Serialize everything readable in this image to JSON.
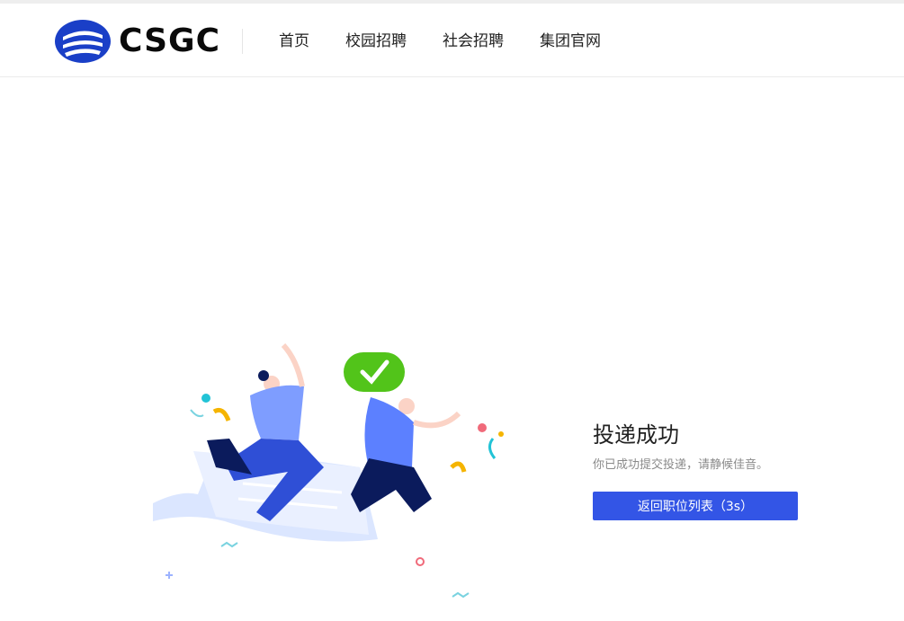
{
  "header": {
    "logo_text": "CSGC",
    "nav": [
      {
        "label": "首页"
      },
      {
        "label": "校园招聘"
      },
      {
        "label": "社会招聘"
      },
      {
        "label": "集团官网"
      }
    ]
  },
  "result": {
    "title": "投递成功",
    "description": "你已成功提交投递，请静候佳音。",
    "button_label": "返回职位列表（3s）"
  },
  "colors": {
    "brand_blue": "#1a3fc7",
    "button_blue": "#3355e6",
    "check_green": "#52c41a"
  }
}
